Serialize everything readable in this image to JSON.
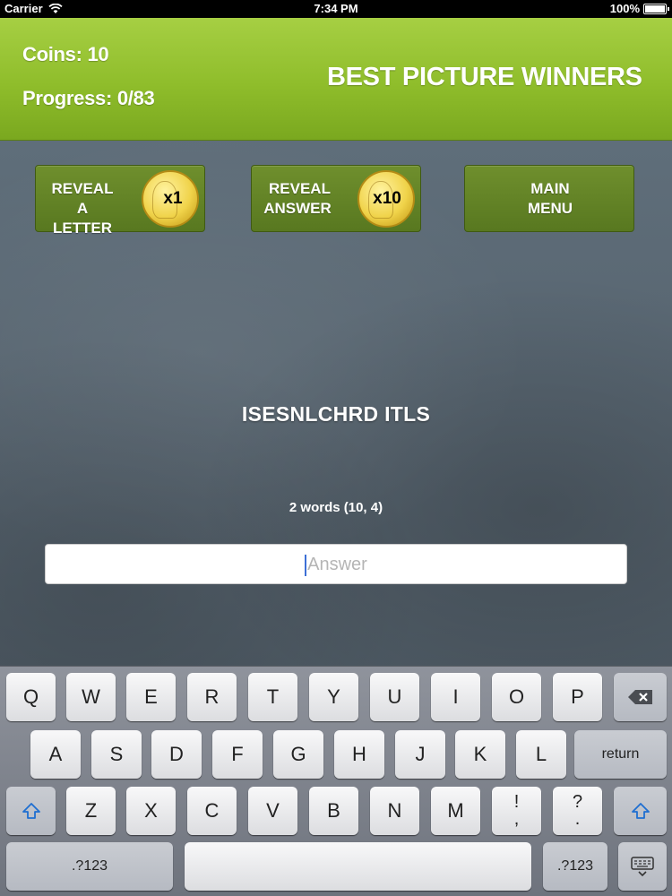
{
  "status_bar": {
    "carrier": "Carrier",
    "time": "7:34 PM",
    "battery": "100%"
  },
  "header": {
    "coins_label": "Coins: 10",
    "progress_label": "Progress: 0/83",
    "title": "BEST PICTURE WINNERS"
  },
  "buttons": {
    "reveal_letter": {
      "line1": "REVEAL A",
      "line2": "LETTER",
      "cost": "x1"
    },
    "reveal_answer": {
      "line1": "REVEAL",
      "line2": "ANSWER",
      "cost": "x10"
    },
    "main_menu": {
      "line1": "MAIN",
      "line2": "MENU"
    }
  },
  "puzzle": {
    "anagram": "ISESNLCHRD ITLS",
    "hint": "2 words (10, 4)"
  },
  "answer_input": {
    "placeholder": "Answer",
    "value": ""
  },
  "keyboard": {
    "row1": [
      "Q",
      "W",
      "E",
      "R",
      "T",
      "Y",
      "U",
      "I",
      "O",
      "P"
    ],
    "row2": [
      "A",
      "S",
      "D",
      "F",
      "G",
      "H",
      "J",
      "K",
      "L"
    ],
    "row3": [
      "Z",
      "X",
      "C",
      "V",
      "B",
      "N",
      "M"
    ],
    "punct1": {
      "top": "!",
      "bottom": ","
    },
    "punct2": {
      "top": "?",
      "bottom": "."
    },
    "return_label": "return",
    "numbers_label": ".?123"
  },
  "colors": {
    "header_green": "#8fbd2b",
    "button_green": "#587820",
    "coin_gold": "#f0d34a",
    "caret_blue": "#3d6fd6"
  },
  "icons": {
    "wifi": "wifi-icon",
    "battery": "battery-icon",
    "shift": "shift-arrow-icon",
    "backspace": "backspace-icon",
    "keyboard_hide": "keyboard-dismiss-icon"
  }
}
